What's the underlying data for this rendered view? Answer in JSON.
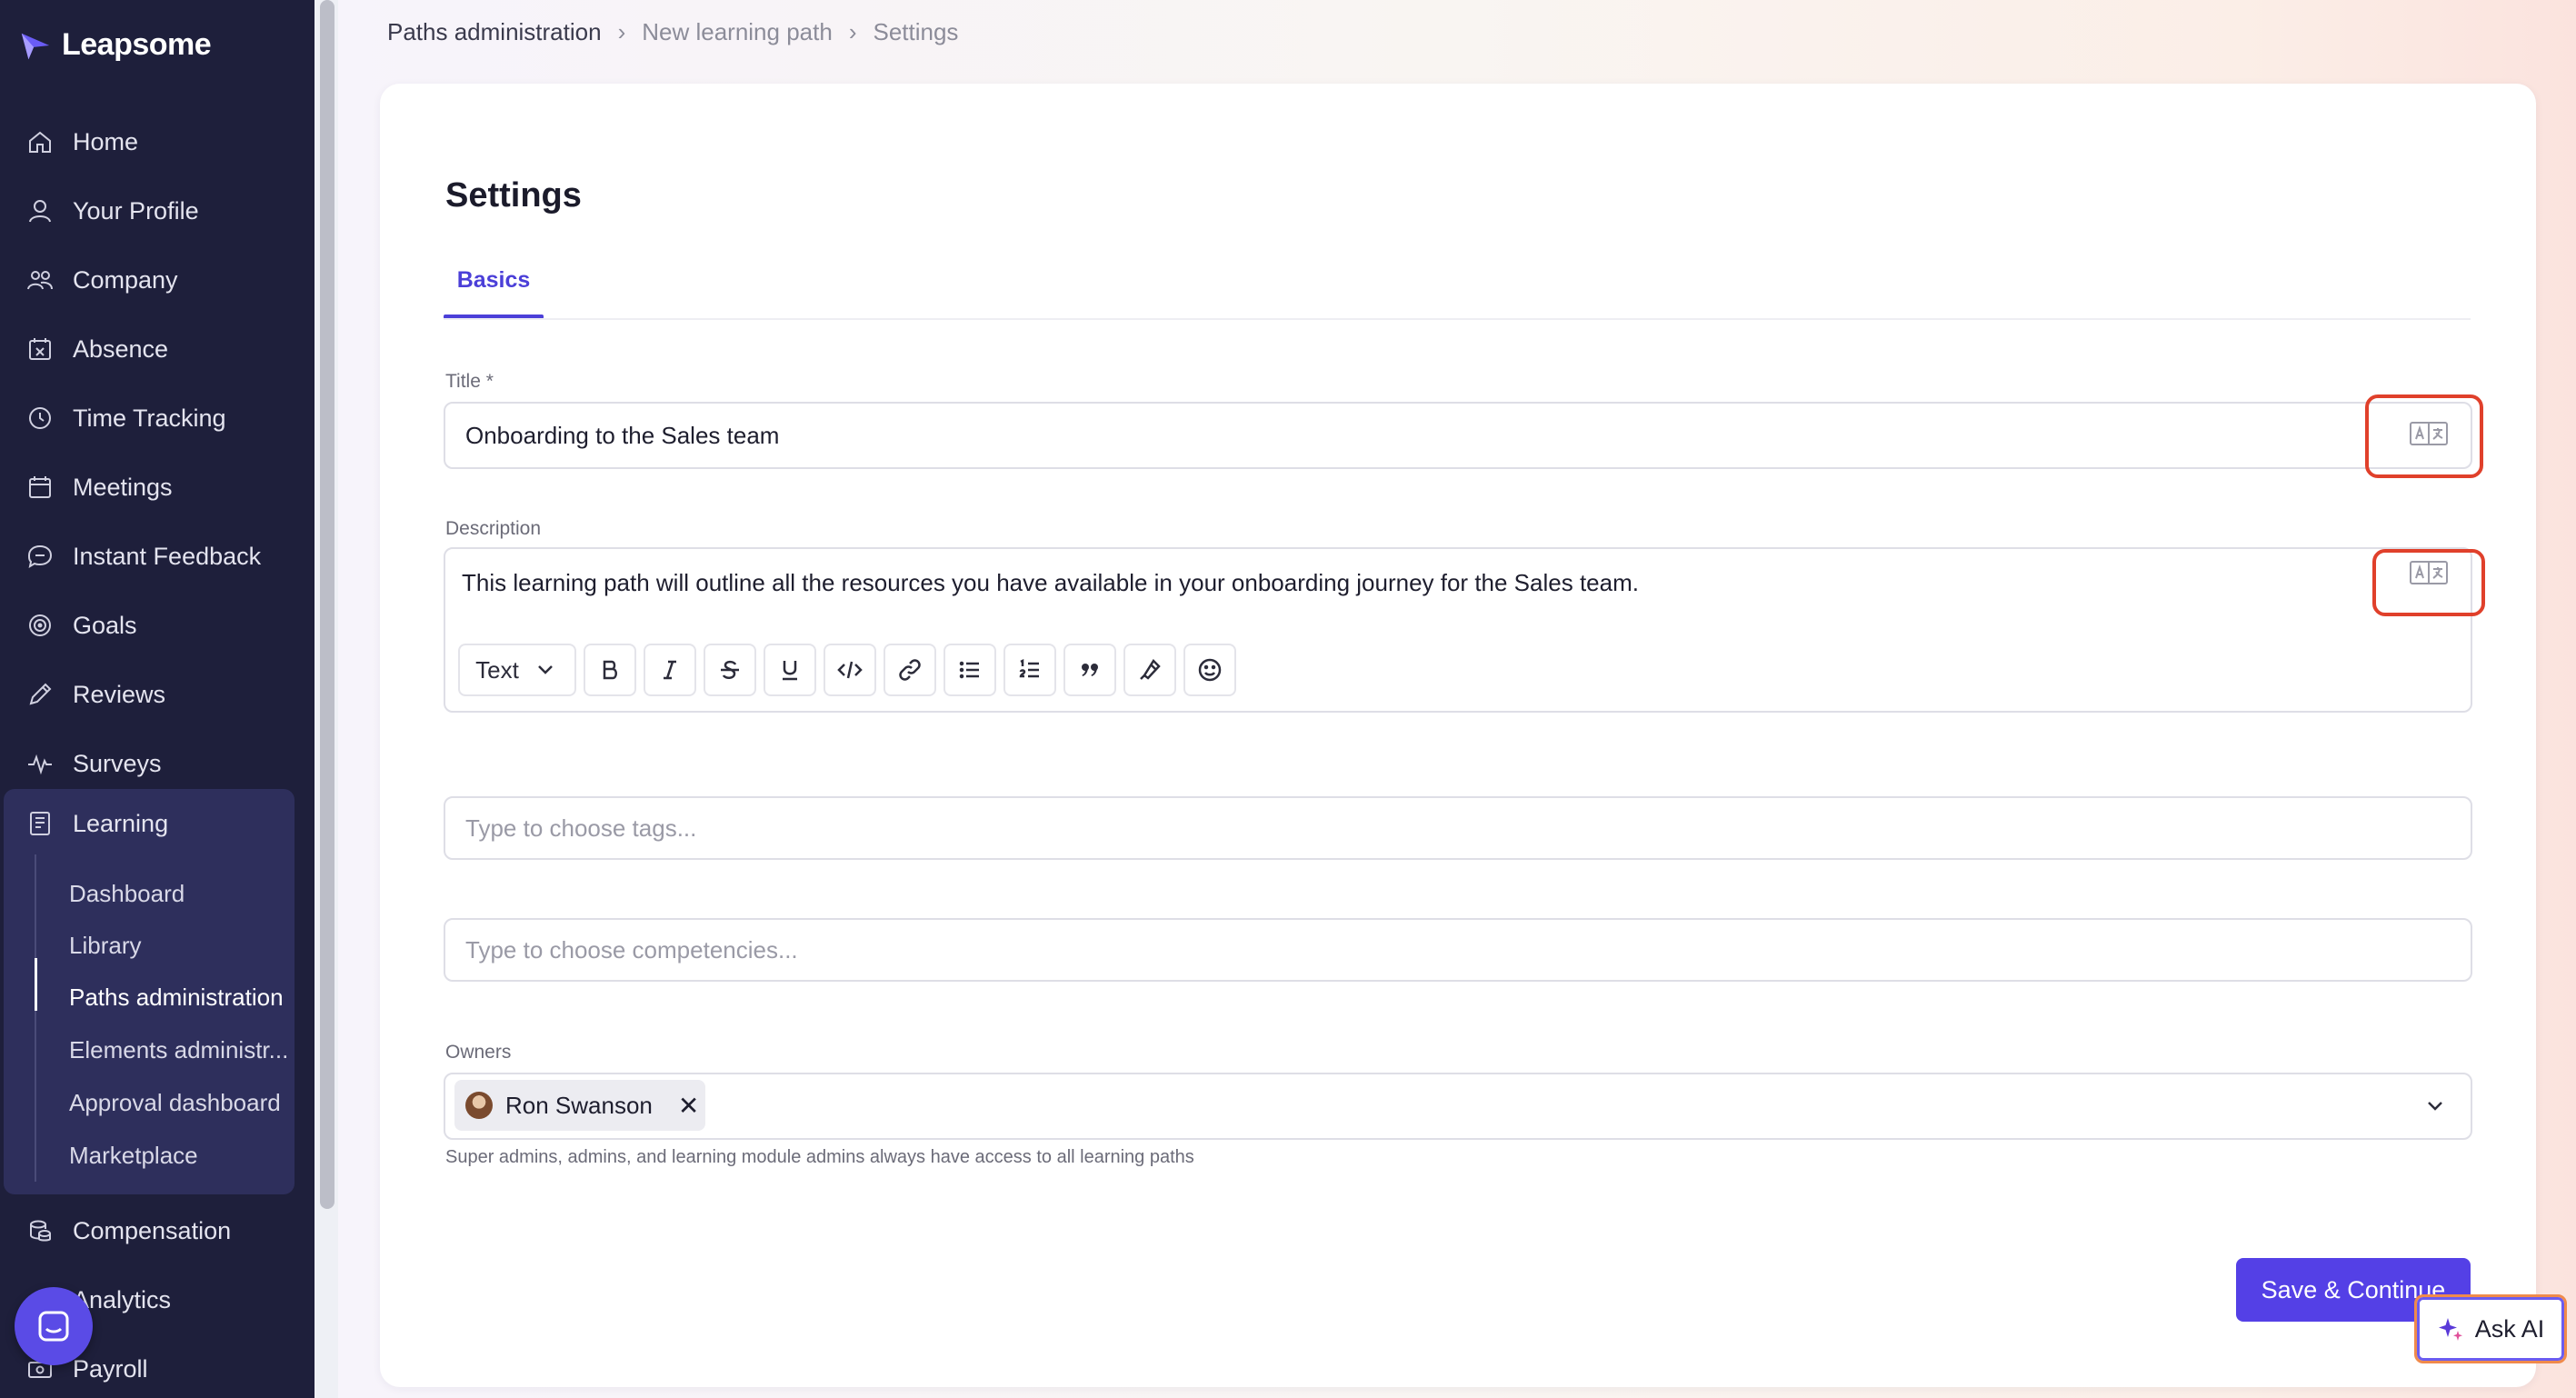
{
  "app": {
    "name": "Leapsome"
  },
  "sidebar": {
    "items": [
      {
        "label": "Home",
        "icon": "home-icon"
      },
      {
        "label": "Your Profile",
        "icon": "user-icon"
      },
      {
        "label": "Company",
        "icon": "people-icon"
      },
      {
        "label": "Absence",
        "icon": "calendar-x-icon"
      },
      {
        "label": "Time Tracking",
        "icon": "clock-icon"
      },
      {
        "label": "Meetings",
        "icon": "calendar-icon"
      },
      {
        "label": "Instant Feedback",
        "icon": "chat-icon"
      },
      {
        "label": "Goals",
        "icon": "target-icon"
      },
      {
        "label": "Reviews",
        "icon": "pen-icon"
      },
      {
        "label": "Surveys",
        "icon": "pulse-icon"
      }
    ],
    "learning": {
      "label": "Learning",
      "sub_items": [
        {
          "label": "Dashboard"
        },
        {
          "label": "Library"
        },
        {
          "label": "Paths administration",
          "active": true
        },
        {
          "label": "Elements administr..."
        },
        {
          "label": "Approval dashboard"
        },
        {
          "label": "Marketplace"
        }
      ]
    },
    "bottom_items": [
      {
        "label": "Compensation",
        "icon": "coins-icon"
      },
      {
        "label": "Analytics",
        "icon": "chart-icon"
      },
      {
        "label": "Payroll",
        "icon": "payroll-icon"
      }
    ]
  },
  "breadcrumb": {
    "items": [
      "Paths administration",
      "New learning path",
      "Settings"
    ]
  },
  "page": {
    "title": "Settings",
    "tabs": [
      {
        "label": "Basics",
        "active": true
      }
    ]
  },
  "form": {
    "title": {
      "label": "Title *",
      "value": "Onboarding to the Sales team"
    },
    "description": {
      "label": "Description",
      "value": "This learning path will outline all the resources you have available in your onboarding journey for the Sales team.",
      "toolbar": {
        "text_style": "Text"
      }
    },
    "tags": {
      "placeholder": "Type to choose tags..."
    },
    "competencies": {
      "placeholder": "Type to choose competencies..."
    },
    "owners": {
      "label": "Owners",
      "selected": [
        {
          "name": "Ron Swanson"
        }
      ],
      "remove_glyph": "✕",
      "helper": "Super admins, admins, and learning module admins always have access to all learning paths"
    },
    "save_label": "Save & Continue"
  },
  "ask_ai": {
    "label": "Ask AI"
  },
  "colors": {
    "sidebar_bg": "#1e1f3b",
    "accent": "#5440e6",
    "highlight": "#e0402b"
  }
}
